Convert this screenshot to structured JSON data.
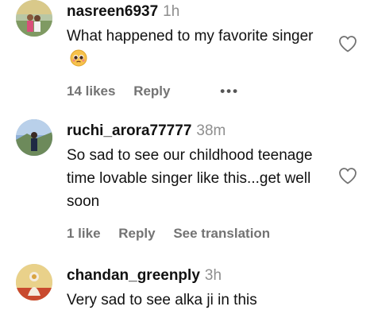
{
  "comments": [
    {
      "username": "nasreen6937",
      "time": "1h",
      "text": "What happened to my favorite singer",
      "emoji_icon": "pleading-face-emoji",
      "likes": "14 likes",
      "reply": "Reply",
      "more": "•••"
    },
    {
      "username": "ruchi_arora77777",
      "time": "38m",
      "text": "So sad to see our childhood teenage time lovable singer like this...get well soon",
      "likes": "1 like",
      "reply": "Reply",
      "translation": "See translation"
    },
    {
      "username": "chandan_greenply",
      "time": "3h",
      "text": "Very sad to see alka ji in this"
    }
  ],
  "icons": {
    "like": "heart-outline-icon"
  },
  "colors": {
    "muted": "#737373",
    "timestamp": "#8e8e8e"
  }
}
